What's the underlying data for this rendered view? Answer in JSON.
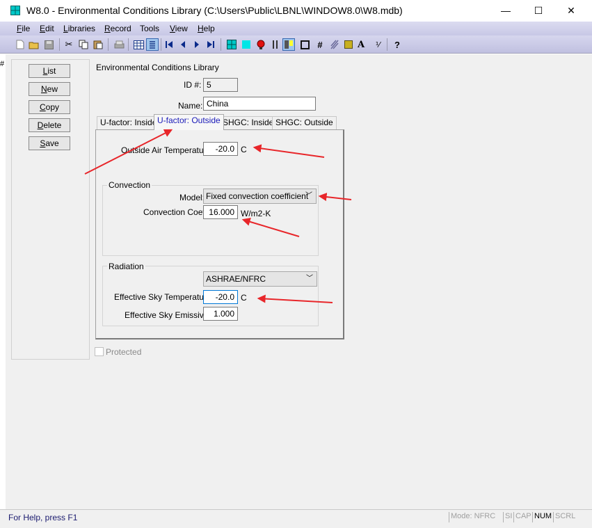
{
  "window": {
    "title": "W8.0 - Environmental Conditions Library (C:\\Users\\Public\\LBNL\\WINDOW8.0\\W8.mdb)",
    "minimize_glyph": "—",
    "maximize_glyph": "☐",
    "close_glyph": "✕"
  },
  "menu": [
    {
      "label": "File",
      "hotkey": "F",
      "rest": "ile"
    },
    {
      "label": "Edit",
      "hotkey": "E",
      "rest": "dit"
    },
    {
      "label": "Libraries",
      "hotkey": "L",
      "rest": "ibraries"
    },
    {
      "label": "Record",
      "hotkey": "R",
      "rest": "ecord"
    },
    {
      "label": "Tools",
      "hotkey": "",
      "rest": "Tools"
    },
    {
      "label": "View",
      "hotkey": "V",
      "rest": "iew"
    },
    {
      "label": "Help",
      "hotkey": "H",
      "rest": "elp"
    }
  ],
  "toolbar_icons": [
    "new-file-icon",
    "open-folder-icon",
    "save-disk-icon",
    "cut-icon",
    "copy-icon",
    "paste-icon",
    "print-icon",
    "list-view-icon",
    "form-view-icon",
    "first-record-icon",
    "previous-record-icon",
    "next-record-icon",
    "last-record-icon",
    "grid-icon",
    "cyan-square-icon",
    "red-circle-icon",
    "pause-bars-icon",
    "highlight-icon",
    "frame-icon",
    "hash-icon",
    "hatch-icon",
    "yellow-square-icon",
    "font-a-icon",
    "fraction-icon",
    "help-question-icon"
  ],
  "side_buttons": [
    {
      "hotkey": "L",
      "rest": "ist",
      "name": "list-button"
    },
    {
      "hotkey": "N",
      "rest": "ew",
      "name": "new-button"
    },
    {
      "hotkey": "C",
      "rest": "opy",
      "name": "copy-button"
    },
    {
      "hotkey": "D",
      "rest": "elete",
      "name": "delete-button"
    },
    {
      "hotkey": "S",
      "rest": "ave",
      "name": "save-button"
    }
  ],
  "form": {
    "heading": "Environmental Conditions Library",
    "id_label": "ID #:",
    "id_value": "5",
    "name_label": "Name:",
    "name_value": "China"
  },
  "tabs": [
    "U-factor: Inside",
    "U-factor: Outside",
    "SHGC: Inside",
    "SHGC: Outside"
  ],
  "active_tab": "U-factor: Outside",
  "outside": {
    "air_temp_label": "Outside Air Temperature",
    "air_temp_value": "-20.0",
    "air_temp_unit": "C",
    "convection_title": "Convection",
    "model_label": "Model:",
    "model_value": "Fixed convection coefficient",
    "coef_label": "Convection Coef.",
    "coef_value": "16.000",
    "coef_unit": "W/m2-K",
    "radiation_title": "Radiation",
    "radiation_model": "ASHRAE/NFRC",
    "sky_temp_label": "Effective Sky Temperature",
    "sky_temp_value": "-20.0",
    "sky_temp_unit": "C",
    "sky_emis_label": "Effective Sky Emissivity",
    "sky_emis_value": "1.000"
  },
  "protected_label": "Protected",
  "status": {
    "help_text": "For Help, press F1",
    "mode": "Mode: NFRC",
    "cells": [
      "SI",
      "CAP",
      "NUM",
      "SCRL"
    ]
  },
  "annotation_color": "#e8262a"
}
